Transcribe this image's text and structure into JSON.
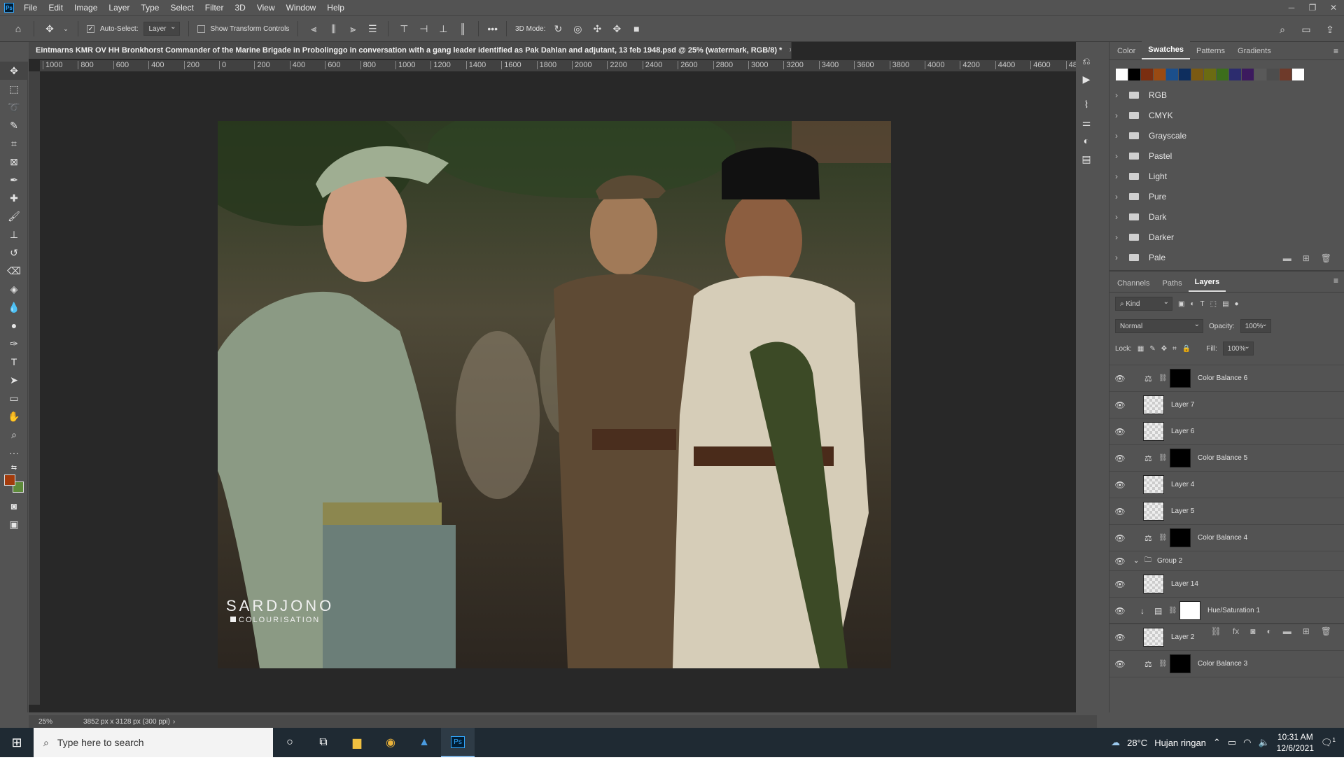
{
  "app": {
    "logo": "Ps"
  },
  "menu": [
    "File",
    "Edit",
    "Image",
    "Layer",
    "Type",
    "Select",
    "Filter",
    "3D",
    "View",
    "Window",
    "Help"
  ],
  "options_bar": {
    "auto_select_label": "Auto-Select:",
    "auto_select_value": "Layer",
    "show_transform_label": "Show Transform Controls",
    "more": "•••",
    "mode_3d_label": "3D Mode:"
  },
  "document": {
    "tab_title": "Eintmarns KMR OV HH Bronkhorst Commander of the Marine Brigade in Probolinggo in conversation with a gang leader identified as Pak Dahlan and adjutant, 13 feb 1948.psd @ 25% (watermark, RGB/8) *",
    "close": "×",
    "ruler_ticks": [
      "1000",
      "800",
      "600",
      "400",
      "200",
      "0",
      "200",
      "400",
      "600",
      "800",
      "1000",
      "1200",
      "1400",
      "1600",
      "1800",
      "2000",
      "2200",
      "2400",
      "2600",
      "2800",
      "3000",
      "3200",
      "3400",
      "3600",
      "3800",
      "4000",
      "4200",
      "4400",
      "4600",
      "48"
    ],
    "watermark_line1": "SARDJONO",
    "watermark_line2": "COLOURISATION"
  },
  "status": {
    "zoom": "25%",
    "dimensions": "3852 px x 3128 px (300 ppi)",
    "arrow": "›"
  },
  "swatches_panel": {
    "tabs": [
      "Color",
      "Swatches",
      "Patterns",
      "Gradients"
    ],
    "active_tab": "Swatches",
    "swatch_colors": [
      "#ffffff",
      "#000000",
      "#7a2e10",
      "#9a4a12",
      "#1b4f8c",
      "#0e2e5e",
      "#7b5a12",
      "#6b6b12",
      "#3c6e1c",
      "#2c2c6e",
      "#3c1a5e",
      "#595959",
      "#4d4d4d",
      "#6e3a2a",
      "#ffffff"
    ],
    "folders": [
      "RGB",
      "CMYK",
      "Grayscale",
      "Pastel",
      "Light",
      "Pure",
      "Dark",
      "Darker",
      "Pale"
    ]
  },
  "layers_panel": {
    "tabs": [
      "Channels",
      "Paths",
      "Layers"
    ],
    "active_tab": "Layers",
    "filter_kind": "Kind",
    "blend_mode": "Normal",
    "opacity_label": "Opacity:",
    "opacity_value": "100%",
    "lock_label": "Lock:",
    "fill_label": "Fill:",
    "fill_value": "100%",
    "layers": [
      {
        "name": "Color Balance 6",
        "type": "adjustment",
        "mask": "black"
      },
      {
        "name": "Layer 7",
        "type": "pixel"
      },
      {
        "name": "Layer 6",
        "type": "pixel"
      },
      {
        "name": "Color Balance 5",
        "type": "adjustment",
        "mask": "black"
      },
      {
        "name": "Layer 4",
        "type": "pixel"
      },
      {
        "name": "Layer 5",
        "type": "pixel"
      },
      {
        "name": "Color Balance 4",
        "type": "adjustment",
        "mask": "black"
      },
      {
        "name": "Group 2",
        "type": "group"
      },
      {
        "name": "Layer 14",
        "type": "pixel"
      },
      {
        "name": "Hue/Saturation 1",
        "type": "huesat",
        "mask": "white"
      },
      {
        "name": "Layer 2",
        "type": "pixel"
      },
      {
        "name": "Color Balance 3",
        "type": "adjustment",
        "mask": "black"
      }
    ]
  },
  "taskbar": {
    "search_placeholder": "Type here to search",
    "weather": "28°C",
    "weather_text": "Hujan ringan",
    "time": "10:31 AM",
    "date": "12/6/2021",
    "notif_count": "1"
  }
}
